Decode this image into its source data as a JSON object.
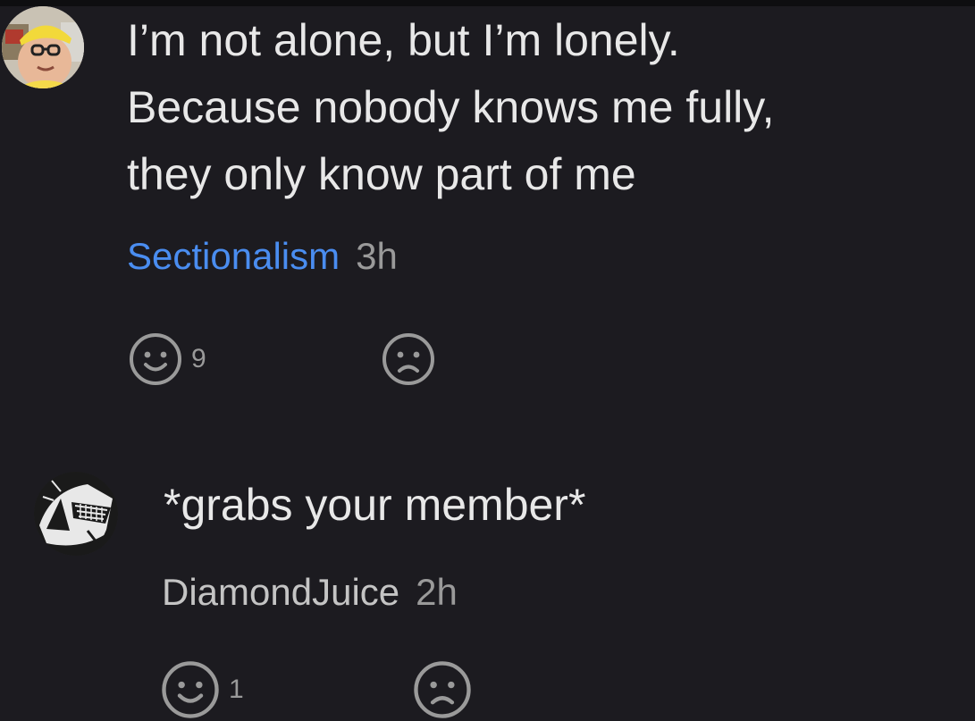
{
  "posts": [
    {
      "text": "I’m not alone, but I’m lonely.\nBecause nobody knows me fully,\nthey only know part of me",
      "author": "Sectionalism",
      "author_color": "#4a8df0",
      "time": "3h",
      "happy_count": "9",
      "avatar_icon": "avatar-person-yellow-cap-icon"
    },
    {
      "text": "*grabs your member*",
      "author": "DiamondJuice",
      "author_color": "#c4c4c4",
      "time": "2h",
      "happy_count": "1",
      "avatar_icon": "avatar-black-white-art-icon"
    }
  ],
  "icons": {
    "happy": "smile-face-icon",
    "sad": "frown-face-icon"
  },
  "colors": {
    "background": "#1c1b20",
    "text": "#e8e8e8",
    "muted": "#9a9a9a",
    "link": "#4a8df0"
  }
}
